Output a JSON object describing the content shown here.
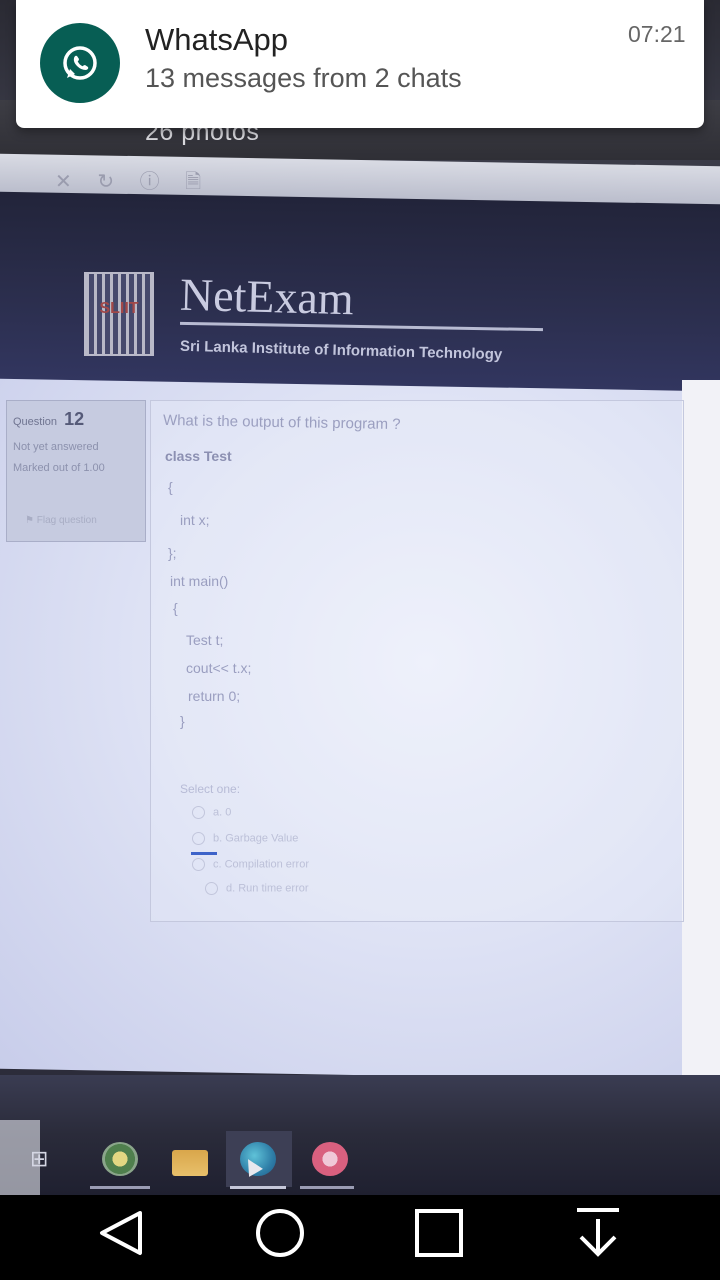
{
  "notification": {
    "app_name": "WhatsApp",
    "text": "13 messages from 2 chats",
    "time": "07:21",
    "icon": "whatsapp-icon"
  },
  "viewer": {
    "photos_label": "26 photos"
  },
  "exam": {
    "brand": "NetExam",
    "logo_text": "SLIIT",
    "subtitle": "Sri Lanka Institute of Information Technology",
    "question_label": "Question",
    "question_number": "12",
    "status": "Not yet answered",
    "marked": "Marked out of 1.00",
    "flag_label": "Flag question",
    "question_text": "What is the output of this program ?",
    "code": [
      "class Test",
      "{",
      "int x;",
      "};",
      "int main()",
      "{",
      "Test t;",
      "cout<< t.x;",
      "return 0;",
      "}"
    ],
    "select_one": "Select one:",
    "options": [
      "a. 0",
      "b. Garbage Value",
      "c. Compilation error",
      "d. Run time error"
    ]
  },
  "navbar": {
    "back_icon": "back-triangle-icon",
    "home_icon": "home-circle-icon",
    "recents_icon": "recents-square-icon",
    "download_icon": "download-arrow-icon"
  }
}
